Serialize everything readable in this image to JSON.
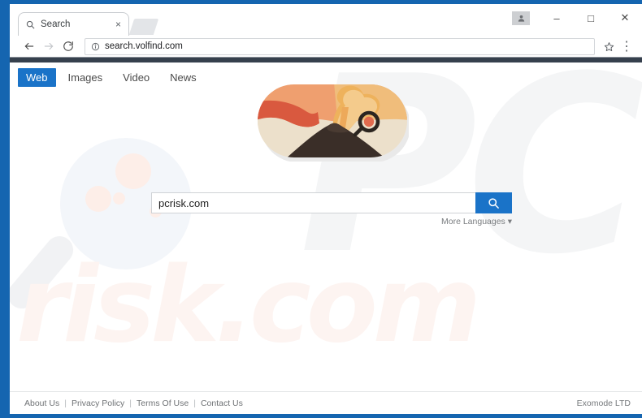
{
  "browser": {
    "tab": {
      "title": "Search",
      "favicon": "search-icon",
      "close": "×"
    },
    "newtab_label": "",
    "window_controls": {
      "profile": "profile-icon",
      "minimize": "–",
      "maximize": "□",
      "close": "✕"
    },
    "toolbar": {
      "back": "←",
      "forward": "→",
      "reload": "↻",
      "info_icon": "info-icon",
      "url": "search.volfind.com",
      "bookmark": "star-icon",
      "menu": "⋮"
    }
  },
  "page": {
    "nav_tabs": [
      {
        "label": "Web",
        "active": true
      },
      {
        "label": "Images",
        "active": false
      },
      {
        "label": "Video",
        "active": false
      },
      {
        "label": "News",
        "active": false
      }
    ],
    "logo": {
      "name": "volcano-logo",
      "description": "volcano with magnifying glass"
    },
    "search": {
      "value": "pcrisk.com",
      "placeholder": "",
      "button_icon": "search-icon",
      "more_languages": "More Languages ▾"
    },
    "watermarks": {
      "brand_top": "PC",
      "brand_bottom": "risk.com"
    },
    "footer": {
      "links": [
        "About Us",
        "Privacy Policy",
        "Terms Of Use",
        "Contact Us"
      ],
      "separator": "|",
      "company": "Exomode LTD"
    }
  },
  "colors": {
    "desktop_blue": "#1565b0",
    "accent_blue": "#1a73c8",
    "dark_bar": "#36404d",
    "logo_sky": "#ef9f6f",
    "logo_lava": "#d9593f",
    "logo_cream": "#ece0cb",
    "logo_mountain": "#3a2e28",
    "logo_plume": "#eeb25c"
  }
}
